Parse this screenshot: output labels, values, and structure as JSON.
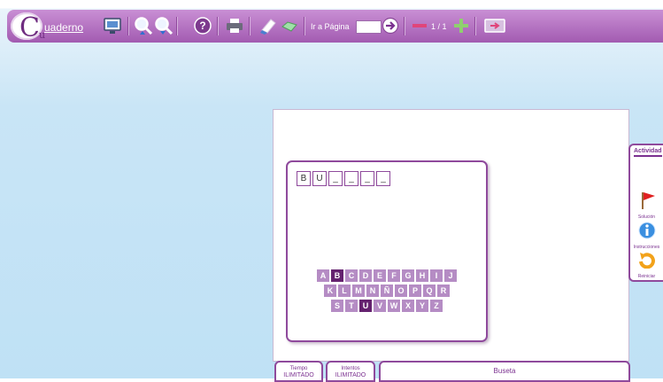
{
  "toolbar": {
    "logo_text": "uaderno",
    "goto_label": "Ir a Página",
    "goto_value": "",
    "page_count": "1 / 1",
    "icons": [
      "display-icon",
      "zoom-in-icon",
      "zoom-out-icon",
      "help-icon",
      "print-icon",
      "eraser-icon",
      "check-icon",
      "go-arrow-icon",
      "minus-icon",
      "plus-icon",
      "full-screen-icon"
    ]
  },
  "word": {
    "cells": [
      "B",
      "U",
      "_",
      "_",
      "_",
      "_"
    ]
  },
  "keyboard": {
    "rows": [
      [
        "A",
        "B",
        "C",
        "D",
        "E",
        "F",
        "G",
        "H",
        "I",
        "J"
      ],
      [
        "K",
        "L",
        "M",
        "N",
        "Ñ",
        "O",
        "P",
        "Q",
        "R"
      ],
      [
        "S",
        "T",
        "U",
        "V",
        "W",
        "X",
        "Y",
        "Z"
      ]
    ],
    "used": [
      "B",
      "U"
    ]
  },
  "activity": {
    "title": "Actividad",
    "solution_label": "Solución",
    "instructions_label": "Instrucciones",
    "restart_label": "Reiniciar"
  },
  "status": {
    "time_label": "Tiempo",
    "time_value": "ILIMITADO",
    "tries_label": "Intentos",
    "tries_value": "ILIMITADO",
    "game_title": "Buseta"
  },
  "colors": {
    "accent": "#8f4a9c",
    "key": "#b58cc4",
    "key_used": "#65226f"
  }
}
